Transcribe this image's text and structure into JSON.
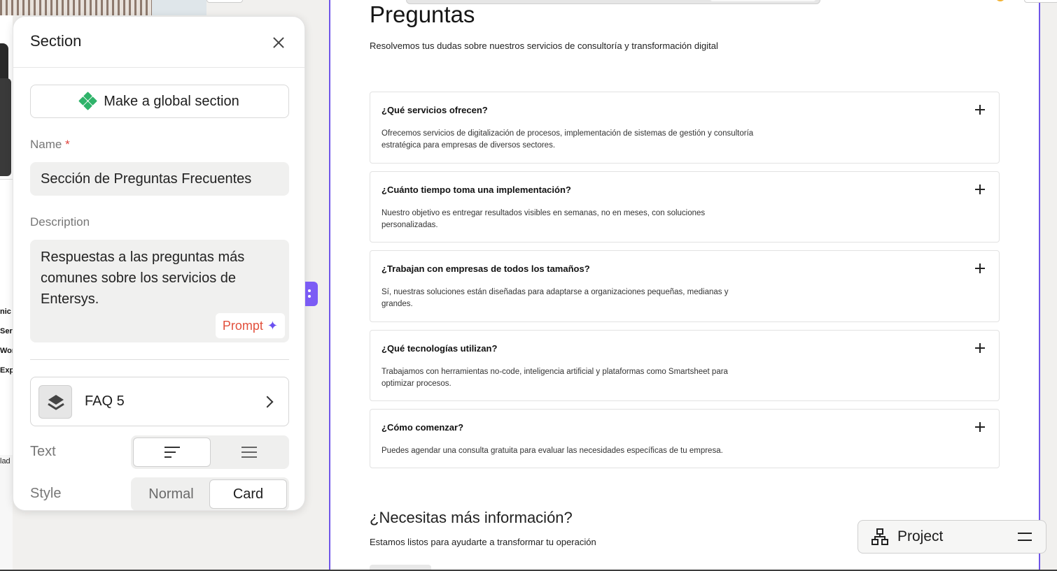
{
  "panel": {
    "title": "Section",
    "global_button_label": "Make a global section",
    "name_label": "Name",
    "name_required_mark": "*",
    "name_value": "Sección de Preguntas Frecuentes",
    "description_label": "Description",
    "description_value": "Respuestas a las preguntas más comunes sobre los servicios de Entersys.",
    "prompt_button_label": "Prompt",
    "layout_name": "FAQ 5",
    "text_label": "Text",
    "style_label": "Style",
    "style_options": [
      "Normal",
      "Card"
    ],
    "style_selected": "Card"
  },
  "background_labels": [
    "nic",
    "Ser",
    "Wor",
    "Exp"
  ],
  "background_bottom_label": "lad",
  "preview": {
    "title": "Preguntas",
    "subtitle": "Resolvemos tus dudas sobre nuestros servicios de consultoría y transformación digital",
    "faqs": [
      {
        "q": "¿Qué servicios ofrecen?",
        "a": "Ofrecemos servicios de digitalización de procesos, implementación de sistemas de gestión y consultoría estratégica para empresas de diversos sectores."
      },
      {
        "q": "¿Cuánto tiempo toma una implementación?",
        "a": "Nuestro objetivo es entregar resultados visibles en semanas, no en meses, con soluciones personalizadas."
      },
      {
        "q": "¿Trabajan con empresas de todos los tamaños?",
        "a": "Sí, nuestras soluciones están diseñadas para adaptarse a organizaciones pequeñas, medianas y grandes."
      },
      {
        "q": "¿Qué tecnologías utilizan?",
        "a": "Trabajamos con herramientas no-code, inteligencia artificial y plataformas como Smartsheet para optimizar procesos."
      },
      {
        "q": "¿Cómo comenzar?",
        "a": "Puedes agendar una consulta gratuita para evaluar las necesidades específicas de tu empresa."
      }
    ],
    "more_title": "¿Necesitas más información?",
    "more_subtitle": "Estamos listos para ayudarte a transformar tu operación"
  },
  "project_button_label": "Project",
  "colors": {
    "accent_purple": "#6f55e8",
    "global_icon_green": "#2fb36a",
    "prompt_text": "#e2513d",
    "required_red": "#e0443e"
  }
}
